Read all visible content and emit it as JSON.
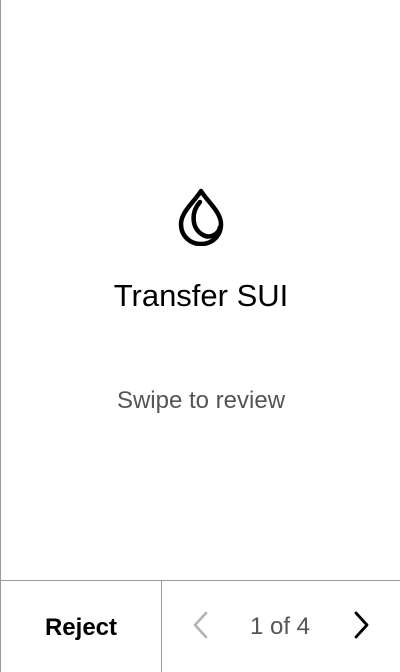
{
  "screen": {
    "icon": "sui-droplet-logo",
    "title": "Transfer SUI",
    "hint": "Swipe to review"
  },
  "footer": {
    "reject_label": "Reject",
    "pager": {
      "current": "1",
      "separator": "of",
      "total": "4",
      "prev_icon": "chevron-left-icon",
      "next_icon": "chevron-right-icon",
      "prev_color": "#b3b3b3",
      "next_color": "#000000"
    }
  }
}
